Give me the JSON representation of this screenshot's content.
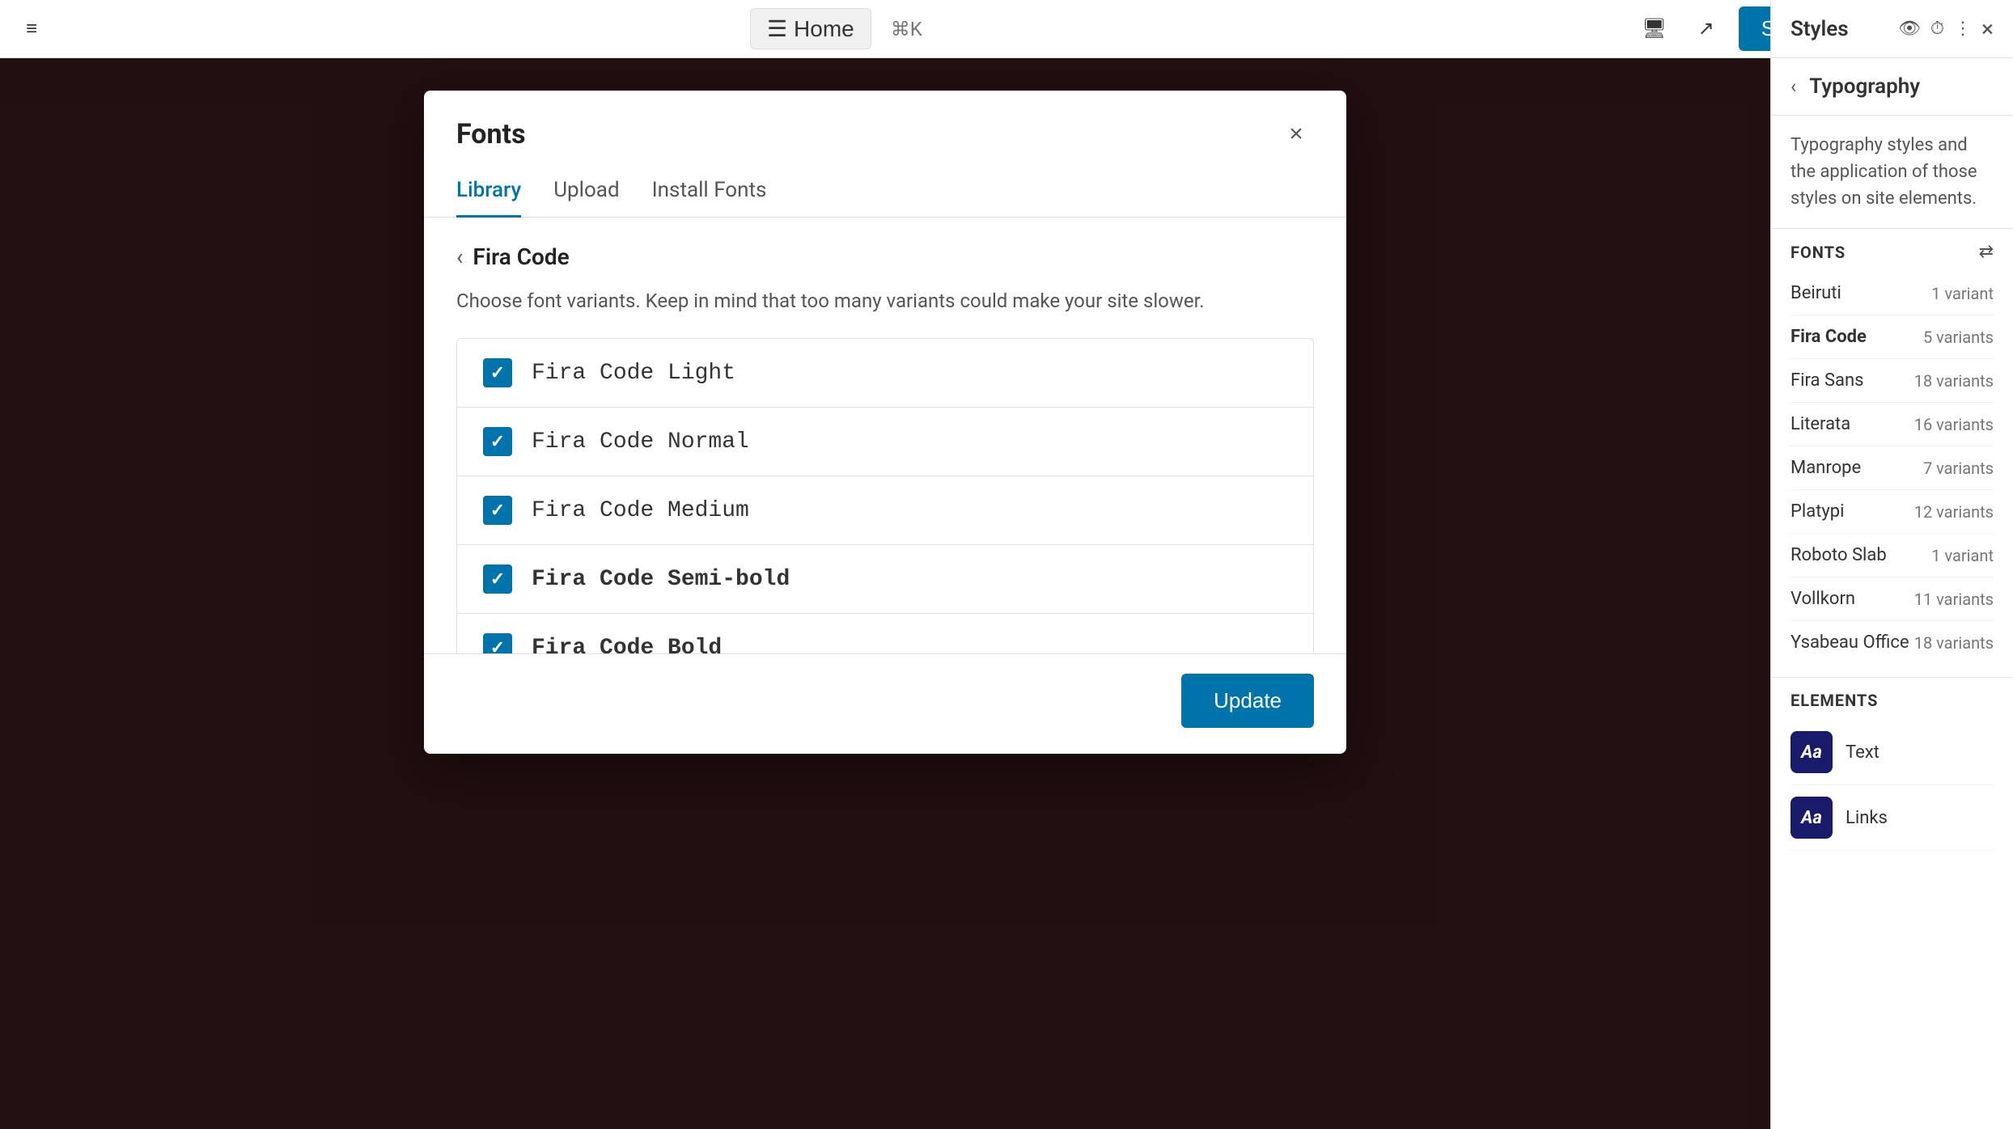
{
  "topbar": {
    "hamburger": "☰",
    "home_icon": "☰",
    "home_label": "Home",
    "keyboard_shortcut": "⌘K",
    "save_label": "Save",
    "icons": {
      "monitor": "🖥",
      "external": "↗",
      "layout": "⬜",
      "more": "⋮"
    }
  },
  "sidebar": {
    "title": "Styles",
    "sub_title": "Typography",
    "description": "Typography styles and the application of those styles on site elements.",
    "fonts_section_title": "FONTS",
    "fonts": [
      {
        "name": "Beiruti",
        "variants": "1 variant",
        "bold": false
      },
      {
        "name": "Fira Code",
        "variants": "5 variants",
        "bold": true
      },
      {
        "name": "Fira Sans",
        "variants": "18 variants",
        "bold": false
      },
      {
        "name": "Literata",
        "variants": "16 variants",
        "bold": false
      },
      {
        "name": "Manrope",
        "variants": "7 variants",
        "bold": false
      },
      {
        "name": "Platypi",
        "variants": "12 variants",
        "bold": false
      },
      {
        "name": "Roboto Slab",
        "variants": "1 variant",
        "bold": false
      },
      {
        "name": "Vollkorn",
        "variants": "11 variants",
        "bold": false
      },
      {
        "name": "Ysabeau Office",
        "variants": "18 variants",
        "bold": false
      }
    ],
    "elements_section_title": "ELEMENTS",
    "elements": [
      {
        "name": "Text",
        "icon": "Aa"
      },
      {
        "name": "Links",
        "icon": "Aa"
      }
    ]
  },
  "modal": {
    "title": "Fonts",
    "close_label": "×",
    "tabs": [
      {
        "label": "Library",
        "active": true
      },
      {
        "label": "Upload",
        "active": false
      },
      {
        "label": "Install Fonts",
        "active": false
      }
    ],
    "breadcrumb_back": "‹",
    "breadcrumb_label": "Fira Code",
    "description": "Choose font variants. Keep in mind that too many variants could make your site slower.",
    "variants": [
      {
        "name": "Fira Code Light",
        "weight": "light",
        "checked": true
      },
      {
        "name": "Fira Code Normal",
        "weight": "normal",
        "checked": true
      },
      {
        "name": "Fira Code Medium",
        "weight": "medium",
        "checked": true
      },
      {
        "name": "Fira Code Semi-bold",
        "weight": "semibold",
        "checked": true
      },
      {
        "name": "Fira Code Bold",
        "weight": "bold-weight",
        "checked": true
      }
    ],
    "update_label": "Update"
  }
}
